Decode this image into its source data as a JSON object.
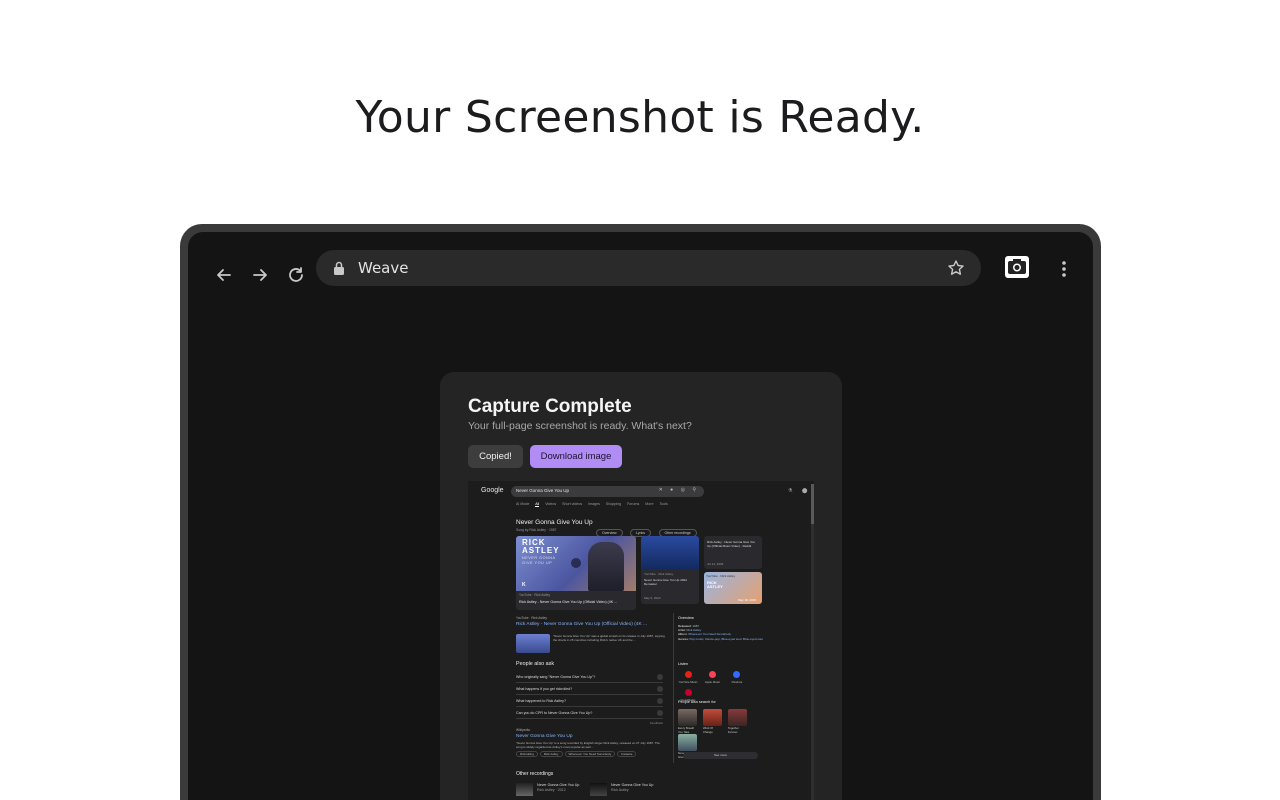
{
  "page": {
    "heading": "Your Screenshot is Ready."
  },
  "browser": {
    "url": "Weave"
  },
  "dialog": {
    "title": "Capture Complete",
    "subtitle": "Your full-page screenshot is ready. What's next?",
    "copied_label": "Copied!",
    "download_label": "Download image"
  },
  "preview": {
    "logo": "Google",
    "search_query": "Never Gonna Give You Up",
    "tabs": [
      "AI Mode",
      "All",
      "Videos",
      "Short videos",
      "Images",
      "Shopping",
      "Forums",
      "More",
      "Tools"
    ],
    "kp_title": "Never Gonna Give You Up",
    "kp_sub": "Song by Rick Astley · 1987",
    "chips": [
      "Overview",
      "Lyrics",
      "Other recordings"
    ],
    "video_main_text": "RICK\nASTLEY",
    "video_main_sub": "NEVER GONNA\nGIVE YOU UP",
    "video_main_badge": "K",
    "video_main_channel": "YouTube · Rick Astley",
    "video_main_title": "Rick Astley - Never Gonna Give You Up (Official Video) (4K ...",
    "video_small1_meta": "YouTube · Rick Astley",
    "video_small1_title": "Never Gonna Give You Up 2022 Remaster",
    "video_small1_date": "May 6, 2022",
    "video_small2_title": "Rick Astley - Never Gonna Give You Up (Official Music Video) - Reddit",
    "video_small2_date": "Jul 14, 2009",
    "video_small3_meta": "YouTube · Rick Astley",
    "video_small3_text": "RICK\nASTLEY",
    "video_small3_date": "May 18, 2015",
    "result_source": "YouTube · Rick Astley",
    "result_title": "Rick Astley - Never Gonna Give You Up (Official Video) (4K ...",
    "result_desc": "\"Never Gonna Give You Up\" was a global smash on its release in July 1987, topping the charts in 25 countries including Rick's native UK and the ...",
    "paa_title": "People also ask",
    "paa_items": [
      "Who originally sang \"Never Gonna Give You Up\"?",
      "What happens if you get rickrolled?",
      "What happened to Rick Astley?",
      "Can you do CPR to Never Gonna Give You Up?"
    ],
    "paa_feedback": "Feedback",
    "wiki_source": "Wikipedia",
    "wiki_title": "Never Gonna Give You Up",
    "wiki_desc": "\"Never Gonna Give You Up\" is a song recorded by English singer Rick Astley, released on 27 July 1987. The song is widely regarded as Astley's most popular as well ...",
    "wiki_links": [
      "Rickrolling",
      "Rick Astley",
      "Whenever You Need Somebody",
      "Karaoke"
    ],
    "other_recordings_title": "Other recordings",
    "rec1_title": "Never Gonna Give You Up",
    "rec1_meta": "Rick Astley · 2012",
    "rec2_title": "Never Gonna Give You Up",
    "rec2_meta": "Rick Astley",
    "overview_title": "Overview",
    "overview_rows": [
      {
        "k": "Released:",
        "v": "1987"
      },
      {
        "k": "Artist:",
        "v": "Rick Astley"
      },
      {
        "k": "Album:",
        "v": "Whenever You Need Somebody"
      },
      {
        "k": "Genres:",
        "v": "Pop music, Dance-pop, Blue-eyed soul, Blue-eyed soul"
      }
    ],
    "listen_title": "Listen",
    "listen_items": [
      "YouTube Music",
      "Apple Music",
      "Pandora",
      "iHeartRadio"
    ],
    "pas_title": "People also search for",
    "pas_items": [
      "Every Breath You Take",
      "Wind Of Change",
      "Together Forever",
      "Never Gonna Give You Up"
    ],
    "pas_more": "See more"
  },
  "colors": {
    "accent": "#b28cf5",
    "frame": "#3a3a3a",
    "background": "#141414"
  }
}
